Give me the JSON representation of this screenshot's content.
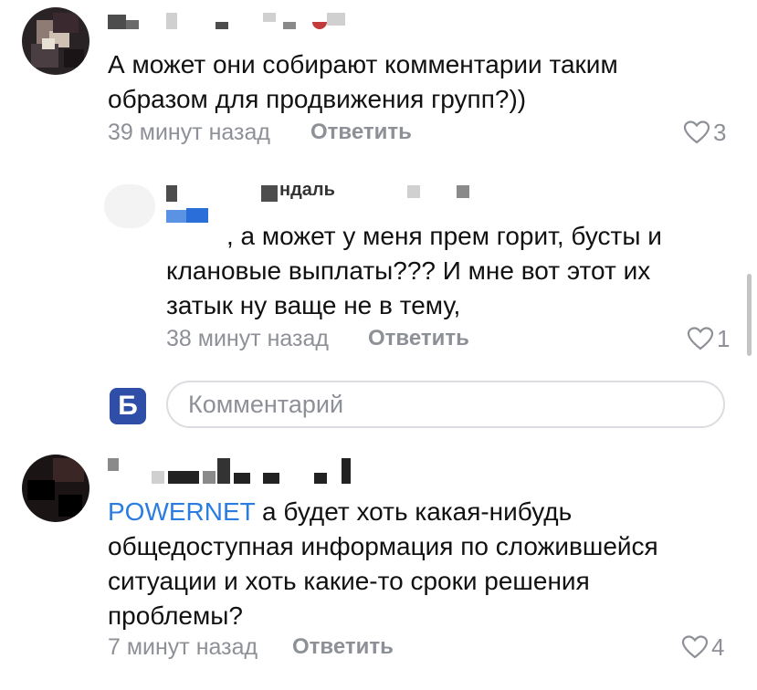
{
  "comments": [
    {
      "text": "А может они собирают комментарии таким\nобразом для продвижения групп?))",
      "time": "39 минут назад",
      "reply_label": "Ответить",
      "likes": "3"
    },
    {
      "name_fragment": "ндаль",
      "text": ", а может у меня прем горит, бусты и\nклановые выплаты???  И мне вот этот их\nзатык ну ваще не в тему,",
      "time": "38 минут назад",
      "reply_label": "Ответить",
      "likes": "1"
    },
    {
      "mention": "POWERNET",
      "text": " а будет хоть какая-нибудь\nобщедоступная информация по сложившейся\nситуации и хоть какие-то сроки решения\nпроблемы?",
      "time": "7 минут назад",
      "reply_label": "Ответить",
      "likes": "4"
    }
  ],
  "composer": {
    "logo": "Б",
    "placeholder": "Комментарий"
  },
  "colors": {
    "mention": "#2a7ce0",
    "meta": "#8d9096",
    "logo_bg": "#2f4ea8"
  },
  "icons": [
    "heart-icon",
    "heart-icon",
    "heart-icon"
  ]
}
